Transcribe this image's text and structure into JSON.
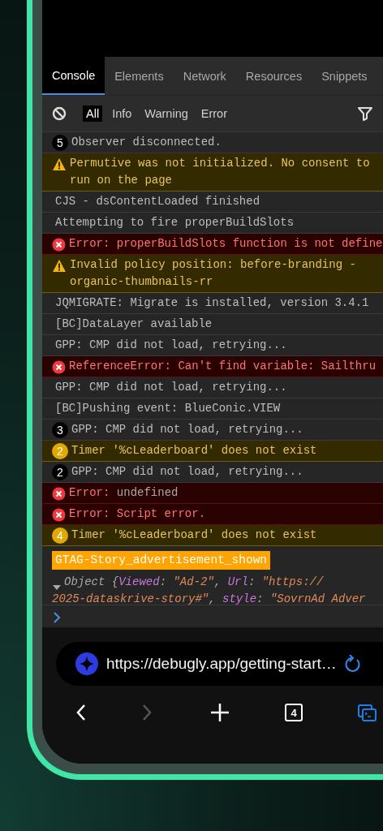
{
  "devtools": {
    "tabs": [
      {
        "label": "Console",
        "selected": true
      },
      {
        "label": "Elements",
        "selected": false
      },
      {
        "label": "Network",
        "selected": false
      },
      {
        "label": "Resources",
        "selected": false
      },
      {
        "label": "Snippets",
        "selected": false
      }
    ],
    "filters": [
      {
        "label": "All",
        "selected": true
      },
      {
        "label": "Info",
        "selected": false
      },
      {
        "label": "Warning",
        "selected": false
      },
      {
        "label": "Error",
        "selected": false
      }
    ]
  },
  "console": {
    "messages": [
      {
        "kind": "log",
        "count": "5",
        "text": "Observer disconnected."
      },
      {
        "kind": "warning",
        "text": "Permutive was not initialized. No consent to run on the page"
      },
      {
        "kind": "log",
        "text": "CJS - dsContentLoaded finished"
      },
      {
        "kind": "log",
        "text": "Attempting to fire properBuildSlots"
      },
      {
        "kind": "error",
        "text": "Error: properBuildSlots function is not define"
      },
      {
        "kind": "warning",
        "text": "Invalid policy position: before-branding - organic-thumbnails-rr"
      },
      {
        "kind": "log",
        "text": "JQMIGRATE: Migrate is installed, version 3.4.1"
      },
      {
        "kind": "log",
        "text": "[BC]DataLayer available"
      },
      {
        "kind": "log",
        "text": "GPP: CMP did not load, retrying..."
      },
      {
        "kind": "error",
        "text": "ReferenceError: Can't find variable: Sailthru"
      },
      {
        "kind": "log",
        "text": "GPP: CMP did not load, retrying..."
      },
      {
        "kind": "log",
        "text": "[BC]Pushing event: BlueConic.VIEW"
      },
      {
        "kind": "log",
        "count": "3",
        "text": "GPP: CMP did not load, retrying..."
      },
      {
        "kind": "warning",
        "count": "2",
        "text": "Timer '%cLeaderboard' does not exist"
      },
      {
        "kind": "log",
        "count": "2",
        "text": "GPP: CMP did not load, retrying..."
      },
      {
        "kind": "error",
        "text": "Error:",
        "value": "undefined"
      },
      {
        "kind": "error",
        "text": "Error: Script error."
      },
      {
        "kind": "warning",
        "count": "4",
        "text": "Timer '%cLeaderboard' does not exist"
      }
    ],
    "group": {
      "label": "GTAG-Story_advertisement_shown",
      "expanded": true,
      "lines": [
        [
          {
            "kind": "plain",
            "text": "Object {"
          },
          {
            "kind": "key",
            "text": "Viewed"
          },
          {
            "kind": "plain",
            "text": ": "
          },
          {
            "kind": "string",
            "text": "\"Ad-2\""
          },
          {
            "kind": "plain",
            "text": ", "
          },
          {
            "kind": "key",
            "text": "Url"
          },
          {
            "kind": "plain",
            "text": ": "
          },
          {
            "kind": "string",
            "text": "\"https://"
          }
        ],
        [
          {
            "kind": "string",
            "text": "2025-dataskrive-story#\""
          },
          {
            "kind": "plain",
            "text": ", "
          },
          {
            "kind": "key",
            "text": "style"
          },
          {
            "kind": "plain",
            "text": ": "
          },
          {
            "kind": "string",
            "text": "\"SovrnAd Adver"
          }
        ]
      ]
    }
  },
  "browser": {
    "url": "https://debugly.app/getting-start…",
    "toolbar": [
      {
        "kind": "back",
        "disabled": false
      },
      {
        "kind": "forward",
        "disabled": true
      },
      {
        "kind": "new-tab",
        "disabled": false
      },
      {
        "kind": "tabs",
        "label": "4",
        "disabled": false
      },
      {
        "kind": "devtools",
        "disabled": false
      }
    ]
  }
}
